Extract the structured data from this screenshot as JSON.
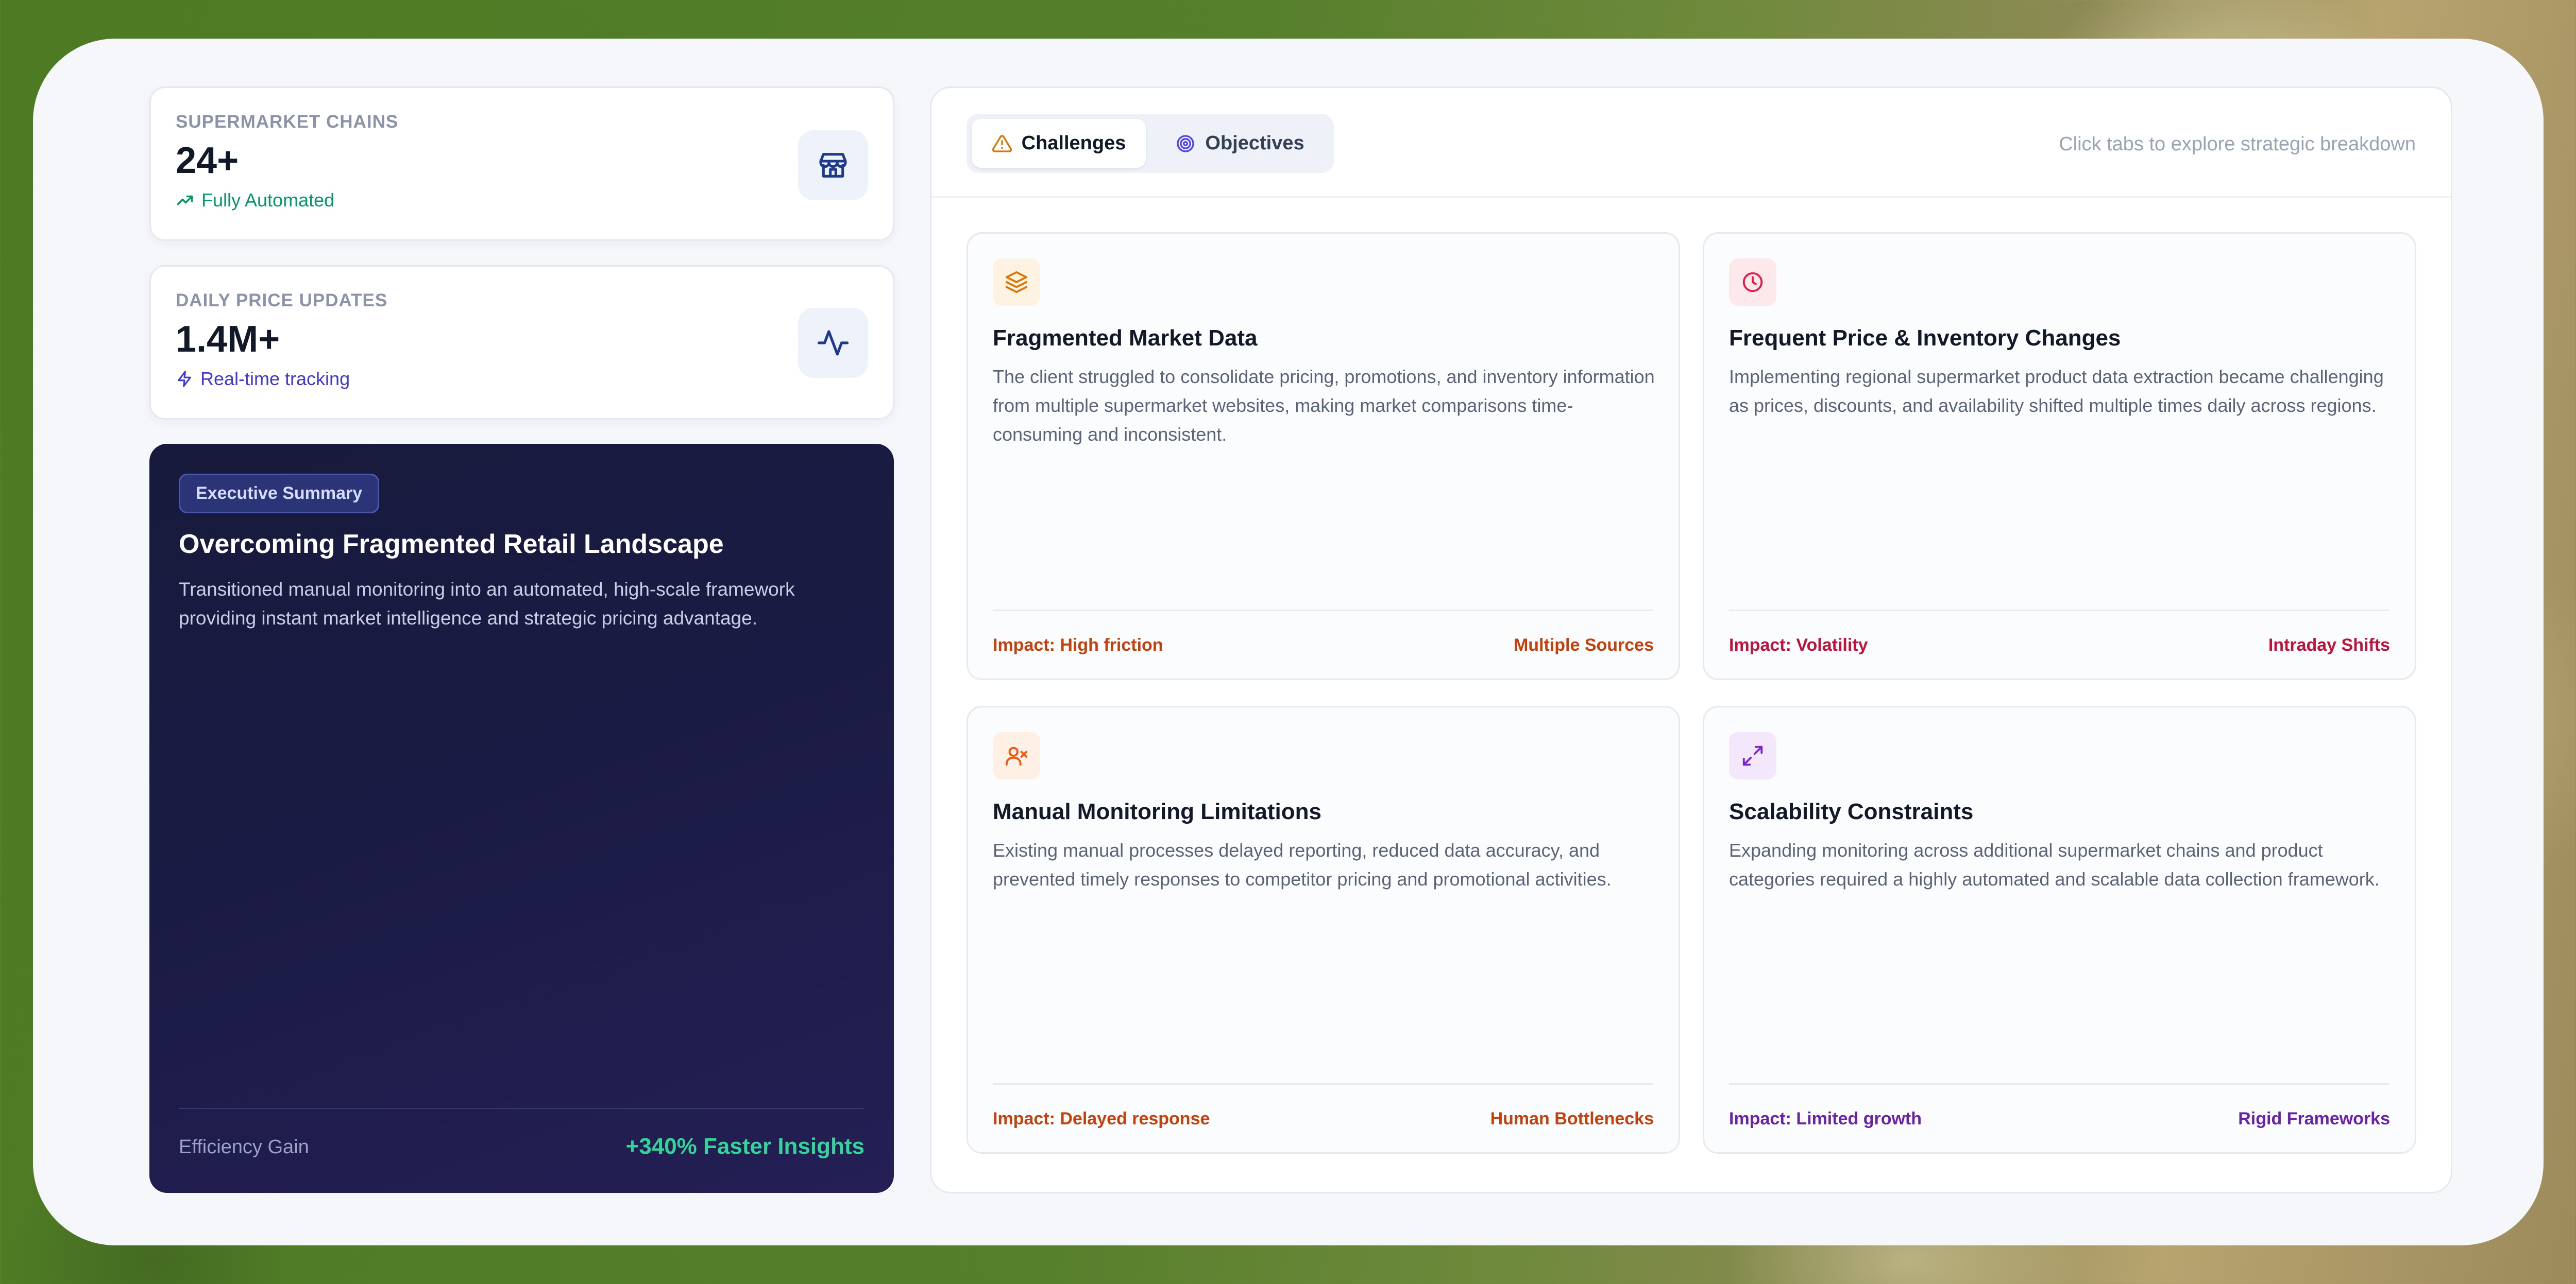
{
  "stats": [
    {
      "label": "SUPERMARKET CHAINS",
      "value": "24+",
      "sub": "Fully Automated",
      "sub_icon": "trending-up-icon",
      "icon": "store-icon",
      "sub_color": "#059669"
    },
    {
      "label": "DAILY PRICE UPDATES",
      "value": "1.4M+",
      "sub": "Real-time tracking",
      "sub_icon": "zap-icon",
      "icon": "activity-icon",
      "sub_color": "#4338ca"
    }
  ],
  "summary": {
    "badge": "Executive Summary",
    "title": "Overcoming Fragmented Retail Landscape",
    "description": "Transitioned manual monitoring into an automated, high-scale framework providing instant market intelligence and strategic pricing advantage.",
    "footer_label": "Efficiency Gain",
    "footer_value": "+340% Faster Insights"
  },
  "tabs": [
    {
      "label": "Challenges",
      "icon": "alert-triangle-icon",
      "active": true
    },
    {
      "label": "Objectives",
      "icon": "target-icon",
      "active": false
    }
  ],
  "hint": "Click tabs to explore strategic breakdown",
  "challenges": [
    {
      "title": "Fragmented Market Data",
      "description": "The client struggled to consolidate pricing, promotions, and inventory information from multiple supermarket websites, making market comparisons time-consuming and inconsistent.",
      "impact": "Impact: High friction",
      "tag": "Multiple Sources",
      "icon": "layers-icon",
      "color": "#c2410c",
      "icon_bg": "#fef3e2"
    },
    {
      "title": "Frequent Price & Inventory Changes",
      "description": "Implementing regional supermarket product data extraction became challenging as prices, discounts, and availability shifted multiple times daily across regions.",
      "impact": "Impact: Volatility",
      "tag": "Intraday Shifts",
      "icon": "clock-icon",
      "color": "#be123c",
      "icon_bg": "#fde8ec"
    },
    {
      "title": "Manual Monitoring Limitations",
      "description": "Existing manual processes delayed reporting, reduced data accuracy, and prevented timely responses to competitor pricing and promotional activities.",
      "impact": "Impact: Delayed response",
      "tag": "Human Bottlenecks",
      "icon": "user-x-icon",
      "color": "#c2410c",
      "icon_bg": "#fef0e4"
    },
    {
      "title": "Scalability Constraints",
      "description": "Expanding monitoring across additional supermarket chains and product categories required a highly automated and scalable data collection framework.",
      "impact": "Impact: Limited growth",
      "tag": "Rigid Frameworks",
      "icon": "maximize-icon",
      "color": "#6b21a8",
      "icon_bg": "#f3e8fb"
    }
  ]
}
